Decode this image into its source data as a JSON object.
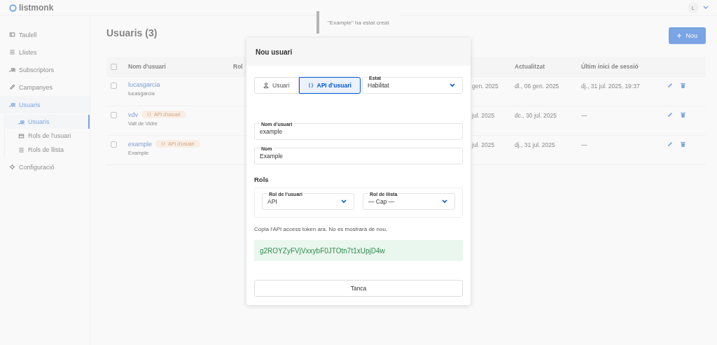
{
  "header": {
    "logo": "listmonk",
    "avatar": "L"
  },
  "toast": {
    "text": "\"Example\" ha estat creat"
  },
  "sidebar": {
    "items": [
      {
        "label": "Taulell",
        "selected": false
      },
      {
        "label": "Llistes",
        "selected": false
      },
      {
        "label": "Subscriptors",
        "selected": false
      },
      {
        "label": "Campanyes",
        "selected": false
      },
      {
        "label": "Usuaris",
        "selected": true,
        "children": [
          {
            "label": "Usuaris",
            "selected": true
          },
          {
            "label": "Rols de l'usuari",
            "selected": false
          },
          {
            "label": "Rols de llista",
            "selected": false
          }
        ]
      },
      {
        "label": "Configuració",
        "selected": false
      }
    ]
  },
  "page": {
    "title": "Usuaris (3)",
    "new_button": "Nou"
  },
  "table": {
    "header_checked": false,
    "columns": [
      {
        "label": "Nom d'usuari"
      },
      {
        "label": "Rol"
      },
      {
        "label": "Actualitzat"
      },
      {
        "label": "Últim inici de sessió"
      }
    ],
    "rows": [
      {
        "checked": false,
        "name": "lucasgarcia",
        "subtitle": "lucasgarcia",
        "column_4": "gen. 2025",
        "updated": "dl., 06 gen. 2025",
        "last_login": "dj., 31 jul. 2025, 19:37"
      },
      {
        "checked": false,
        "name": "vdv",
        "tag": "API d'usuari",
        "subtitle": "Vall de Vidre",
        "column_4": "jul. 2025",
        "updated": "dc., 30 jul. 2025",
        "last_login": "—"
      },
      {
        "checked": false,
        "name": "example",
        "tag": "API d'usuari",
        "subtitle": "Example",
        "column_4": "jul. 2025",
        "updated": "dj., 31 jul. 2025",
        "last_login": "—"
      }
    ]
  },
  "modal": {
    "title": "Nou usuari",
    "types": [
      {
        "label": "Usuari",
        "selected": false
      },
      {
        "label": "API d'usuari",
        "selected": true
      }
    ],
    "status": {
      "label": "Estat",
      "value": "Habilitat"
    },
    "fields": [
      {
        "label": "Nom d'usuari",
        "value": "example"
      },
      {
        "label": "Nom",
        "value": "Example"
      }
    ],
    "roles": {
      "title": "Rols",
      "selects": [
        {
          "label": "Rol de l'usuari",
          "value": "API"
        },
        {
          "label": "Rol de llista",
          "value": "— Cap —"
        }
      ]
    },
    "note": "Copia l'API access token ara. No es mostrarà de nou.",
    "token": "g2ROYZyFVjVxxybF0JTOtn7t1xUpjD4w",
    "close_button": "Tanca"
  }
}
